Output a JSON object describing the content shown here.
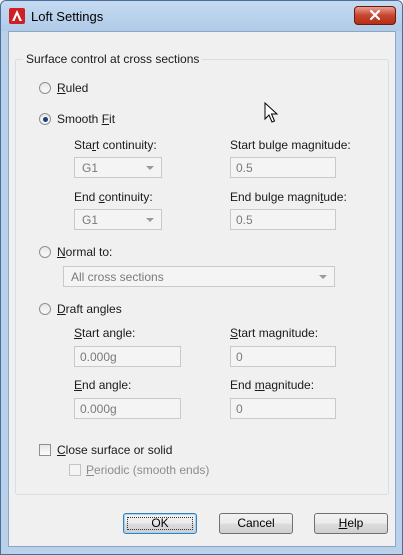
{
  "window": {
    "title": "Loft Settings"
  },
  "group": {
    "legend": "Surface control at cross sections"
  },
  "ruled": {
    "label": "Ruled",
    "mnemonic": "R",
    "rest": "uled",
    "checked": false
  },
  "smooth_fit": {
    "label": "Smooth Fit",
    "pre": "Smooth ",
    "mnemonic": "F",
    "rest": "it",
    "checked": true,
    "start_continuity": {
      "label": "Start continuity:",
      "pre": "Sta",
      "mnemonic": "r",
      "rest": "t continuity:",
      "value": "G1"
    },
    "start_bulge": {
      "label": "Start bulge magnitude:",
      "value": "0.5"
    },
    "end_continuity": {
      "label": "End continuity:",
      "pre": "End ",
      "mnemonic": "c",
      "rest": "ontinuity:",
      "value": "G1"
    },
    "end_bulge": {
      "label": "End bulge magnitude:",
      "pre": "End bulge magni",
      "mnemonic": "t",
      "rest": "ude:",
      "value": "0.5"
    }
  },
  "normal_to": {
    "label": "Normal to:",
    "mnemonic": "N",
    "rest": "ormal to:",
    "checked": false,
    "value": "All cross sections"
  },
  "draft_angles": {
    "label": "Draft angles",
    "mnemonic": "D",
    "rest": "raft angles",
    "checked": false,
    "start_angle": {
      "label": "Start angle:",
      "mnemonic": "S",
      "rest": "tart angle:",
      "value": "0.000g"
    },
    "start_magnitude": {
      "label": "Start magnitude:",
      "mnemonic": "S",
      "rest": "tart magnitude:",
      "value": "0"
    },
    "end_angle": {
      "label": "End angle:",
      "mnemonic": "E",
      "rest": "nd angle:",
      "value": "0.000g"
    },
    "end_magnitude": {
      "label": "End magnitude:",
      "pre": "End ",
      "mnemonic": "m",
      "rest": "agnitude:",
      "value": "0"
    }
  },
  "close_surface": {
    "label": "Close surface or solid",
    "mnemonic": "C",
    "rest": "lose surface or solid",
    "checked": false
  },
  "periodic": {
    "label": "Periodic (smooth ends)",
    "mnemonic": "P",
    "rest": "eriodic (smooth ends)",
    "checked": false
  },
  "buttons": {
    "ok": "OK",
    "cancel": "Cancel",
    "help": "Help",
    "help_mnemonic": "H",
    "help_rest": "elp"
  },
  "colors": {
    "titlebar": "#b9d1ea",
    "close_button": "#c7452f",
    "client": "#f0f0f0"
  },
  "icons": {
    "app": "autocad-icon",
    "close": "close-icon",
    "pointer": "mouse-pointer-icon"
  }
}
